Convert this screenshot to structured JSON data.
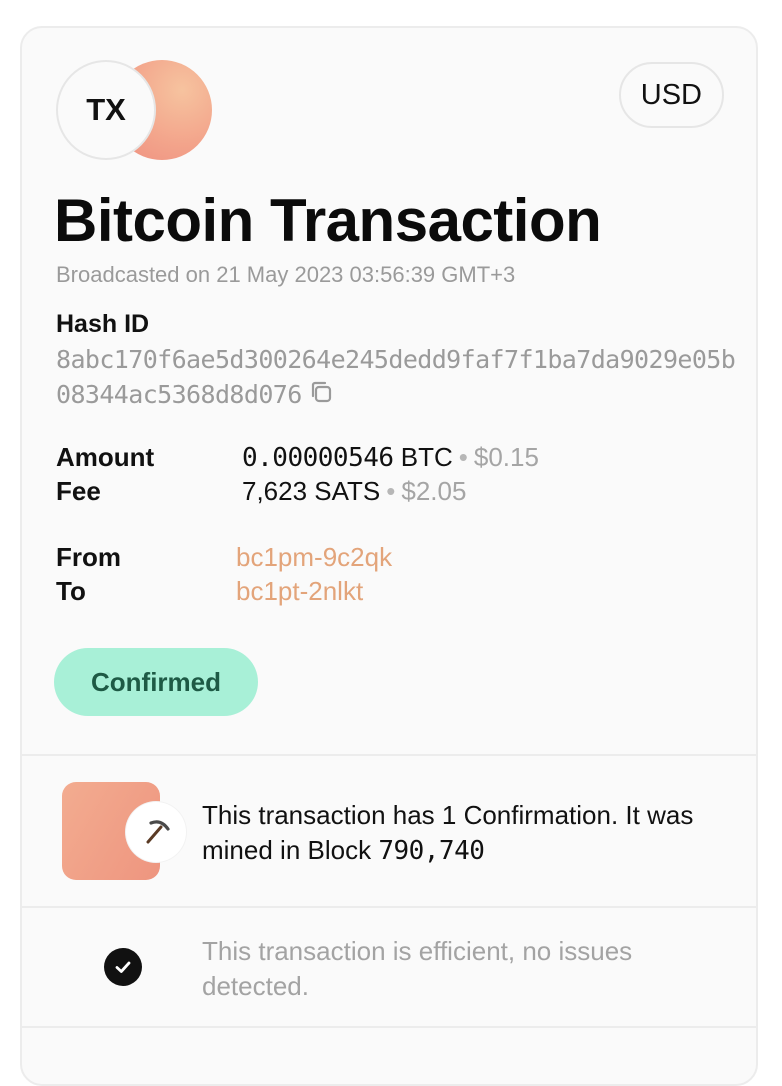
{
  "header": {
    "logo_text": "TX",
    "currency_label": "USD",
    "title": "Bitcoin Transaction",
    "broadcast_text": "Broadcasted on 21 May 2023 03:56:39 GMT+3"
  },
  "hash": {
    "label": "Hash ID",
    "value": "8abc170f6ae5d300264e245dedd9faf7f1ba7da9029e05b08344ac5368d8d076",
    "copy_icon": "copy-icon"
  },
  "amounts": {
    "amount_label": "Amount",
    "amount_btc": "0.00000546",
    "amount_unit": "BTC",
    "amount_fiat": "$0.15",
    "fee_label": "Fee",
    "fee_sats": "7,623 SATS",
    "fee_fiat": "$2.05",
    "separator": "•"
  },
  "addresses": {
    "from_label": "From",
    "from_value": "bc1pm-9c2qk",
    "to_label": "To",
    "to_value": "bc1pt-2nlkt"
  },
  "status": {
    "label": "Confirmed"
  },
  "confirmation": {
    "text_prefix": "This transaction has 1 Confirmation. It was mined in Block ",
    "block_number": "790,740",
    "icon": "pickaxe-icon"
  },
  "efficiency": {
    "text": "This transaction is efficient, no issues detected.",
    "icon": "check-circle-icon"
  },
  "colors": {
    "accent_address": "#e3a47a",
    "status_bg": "#a8f0d7",
    "status_text": "#1e5a45",
    "muted": "#9a9a9a"
  }
}
